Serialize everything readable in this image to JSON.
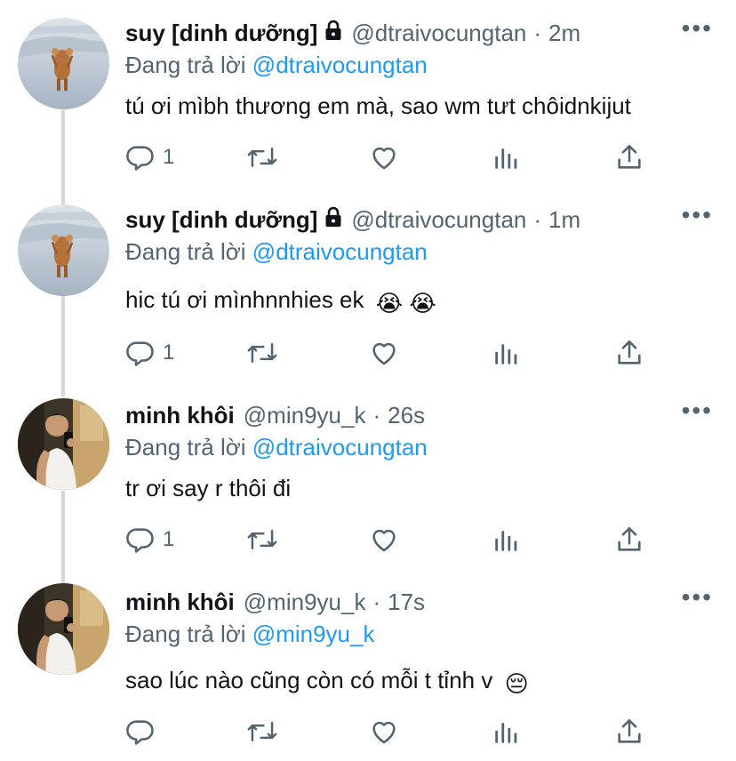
{
  "colors": {
    "text": "#0f1419",
    "secondary": "#536471",
    "accent": "#1d9bf0",
    "thread_line": "#cfd9de"
  },
  "tweets": [
    {
      "name": "suy [dinh dưỡng]",
      "locked": true,
      "handle": "@dtraivocungtan",
      "time": "2m",
      "replying_prefix": "Đang trả lời",
      "replying_to": "@dtraivocungtan",
      "text": "tú ơi mìbh thương em mà, sao wm tưt chôidnkijut",
      "emoji": "",
      "reply_count": "1",
      "avatar": "jerry-avatar"
    },
    {
      "name": "suy [dinh dưỡng]",
      "locked": true,
      "handle": "@dtraivocungtan",
      "time": "1m",
      "replying_prefix": "Đang trả lời",
      "replying_to": "@dtraivocungtan",
      "text": "hic tú ơi mìnhnnhies ek",
      "emoji": "😭 😭",
      "reply_count": "1",
      "avatar": "jerry-avatar"
    },
    {
      "name": "minh khôi",
      "locked": false,
      "handle": "@min9yu_k",
      "time": "26s",
      "replying_prefix": "Đang trả lời",
      "replying_to": "@dtraivocungtan",
      "text": "tr ơi say r thôi đi",
      "emoji": "",
      "reply_count": "1",
      "avatar": "mirror-selfie-avatar"
    },
    {
      "name": "minh khôi",
      "locked": false,
      "handle": "@min9yu_k",
      "time": "17s",
      "replying_prefix": "Đang trả lời",
      "replying_to": "@min9yu_k",
      "text": "sao lúc nào cũng còn có mỗi t tỉnh v",
      "emoji": "😔",
      "reply_count": "",
      "avatar": "mirror-selfie-avatar"
    }
  ],
  "separators": {
    "dot": "·",
    "more": "•••"
  }
}
